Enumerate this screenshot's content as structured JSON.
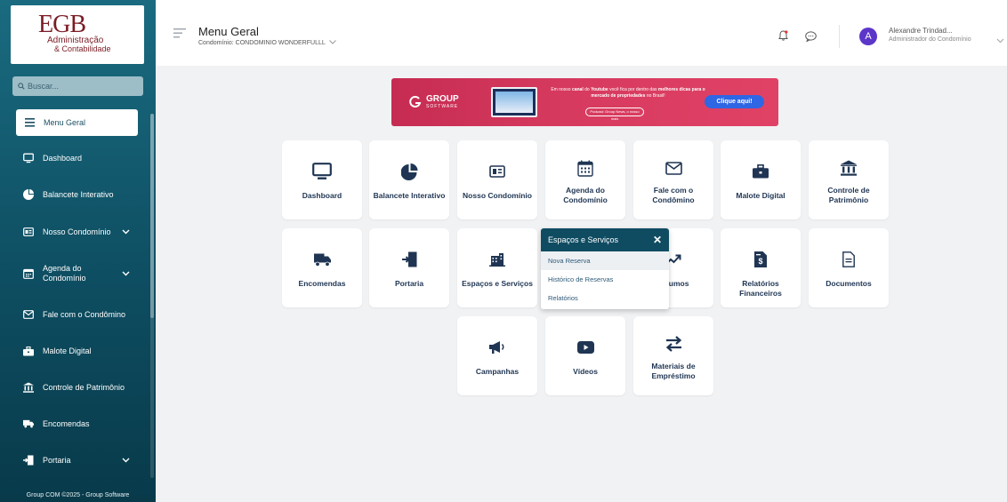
{
  "sidebar": {
    "logo": {
      "main": "EGB",
      "line1": "Administração",
      "line2": "& Contabilidade"
    },
    "search_placeholder": "Buscar...",
    "active_item": "Menu Geral",
    "items": [
      {
        "label": "Dashboard",
        "icon": "monitor-icon"
      },
      {
        "label": "Balancete Interativo",
        "icon": "pie-chart-icon"
      },
      {
        "label": "Nosso Condomínio",
        "icon": "id-card-icon",
        "chevron": true
      },
      {
        "label": "Agenda do Condomínio",
        "icon": "calendar-icon",
        "chevron": true
      },
      {
        "label": "Fale com o Condômino",
        "icon": "envelope-icon"
      },
      {
        "label": "Malote Digital",
        "icon": "briefcase-icon"
      },
      {
        "label": "Controle de Patrimônio",
        "icon": "bank-icon"
      },
      {
        "label": "Encomendas",
        "icon": "truck-icon"
      },
      {
        "label": "Portaria",
        "icon": "door-enter-icon",
        "chevron": true
      }
    ],
    "footer": "Group COM ©2025 - Group Software"
  },
  "header": {
    "title": "Menu Geral",
    "condominium": "Condomínio: CONDOMINIO WONDERFULLL",
    "user_initial": "A",
    "user_name": "Alexandre Trindad...",
    "user_role": "Administrador do Condomínio"
  },
  "banner": {
    "brand": "GROUP",
    "brand_sub": "SOFTWARE",
    "text_1": "Em nosso",
    "text_2": "canal",
    "text_3": "do",
    "text_4": "Youtube",
    "text_5": "você fica por dentro das",
    "text_6": "melhores dicas para o mercado de propriedades",
    "text_7": "no Brasil!",
    "podcast": "Podcast: Group News, o nosso mais",
    "cta": "Clique aqui!"
  },
  "cards": [
    {
      "label": "Dashboard",
      "icon": "monitor-icon"
    },
    {
      "label": "Balancete Interativo",
      "icon": "pie-chart-icon"
    },
    {
      "label": "Nosso Condomínio",
      "icon": "id-card-icon"
    },
    {
      "label": "Agenda do Condomínio",
      "icon": "calendar-icon"
    },
    {
      "label": "Fale com o Condômino",
      "icon": "envelope-icon"
    },
    {
      "label": "Malote Digital",
      "icon": "briefcase-icon"
    },
    {
      "label": "Controle de Patrimônio",
      "icon": "bank-icon"
    },
    {
      "label": "Encomendas",
      "icon": "truck-icon"
    },
    {
      "label": "Portaria",
      "icon": "door-enter-icon"
    },
    {
      "label": "Espaços e Serviços",
      "icon": "building-icon"
    },
    {
      "label": "Insumos",
      "icon": "trend-icon"
    },
    {
      "label": "Relatórios Financeiros",
      "icon": "invoice-icon"
    },
    {
      "label": "Documentos",
      "icon": "document-icon"
    },
    {
      "label": "Campanhas",
      "icon": "megaphone-icon"
    },
    {
      "label": "Vídeos",
      "icon": "play-icon"
    },
    {
      "label": "Materiais de Empréstimo",
      "icon": "swap-icon"
    }
  ],
  "popup": {
    "title": "Espaços e Serviços",
    "items": [
      "Nova Reserva",
      "Histórico de Reservas",
      "Relatórios"
    ]
  },
  "colors": {
    "sidebar": "#0e4e62",
    "accent": "#0f4c62",
    "card_text": "#1f3553",
    "avatar": "#5c35c9",
    "banner": "#d63a5e",
    "cta": "#2f66e4"
  }
}
